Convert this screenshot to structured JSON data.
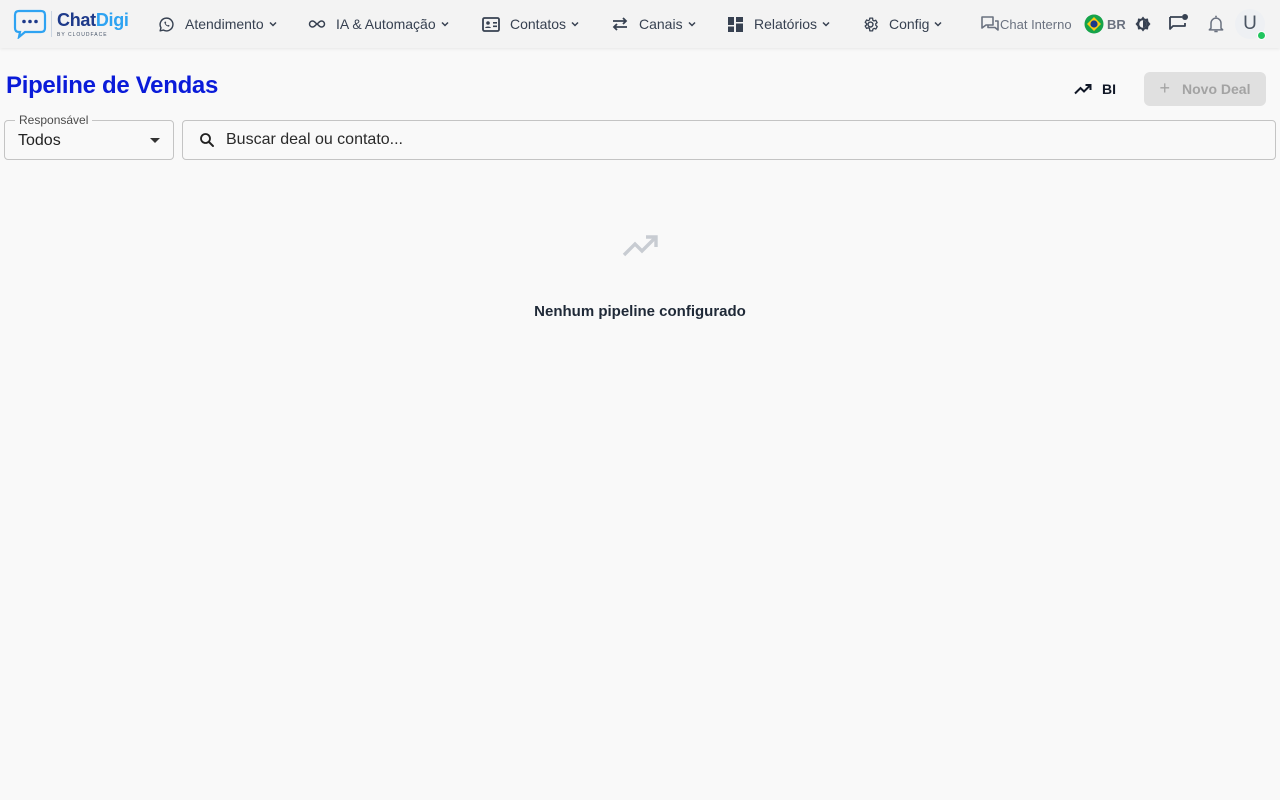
{
  "app": {
    "logo": {
      "word_primary": "Chat",
      "word_secondary": "Digi",
      "tagline": "BY CLOUDFACE"
    }
  },
  "nav": {
    "items": [
      {
        "label": "Atendimento",
        "icon": "whatsapp-icon"
      },
      {
        "label": "IA & Automação",
        "icon": "infinity-icon"
      },
      {
        "label": "Contatos",
        "icon": "contact-card-icon"
      },
      {
        "label": "Canais",
        "icon": "swap-arrows-icon"
      },
      {
        "label": "Relatórios",
        "icon": "dashboard-icon"
      },
      {
        "label": "Config",
        "icon": "gear-icon"
      }
    ]
  },
  "toolbar": {
    "chat_interno_label": "Chat Interno",
    "language_label": "BR",
    "avatar_initial": "U"
  },
  "page": {
    "title": "Pipeline de Vendas",
    "bi_label": "BI",
    "new_deal_label": "Novo Deal",
    "new_deal_disabled": true
  },
  "filters": {
    "responsavel_label": "Responsável",
    "responsavel_value": "Todos",
    "search_placeholder": "Buscar deal ou contato..."
  },
  "empty_state": {
    "message": "Nenhum pipeline configurado",
    "icon": "trending-up-icon"
  },
  "colors": {
    "title": "#0a1bd9",
    "logo_primary": "#1e3a8a",
    "logo_secondary": "#2ea3f2",
    "online_status": "#22c55e",
    "disabled_button_bg": "#e0e0e0"
  }
}
